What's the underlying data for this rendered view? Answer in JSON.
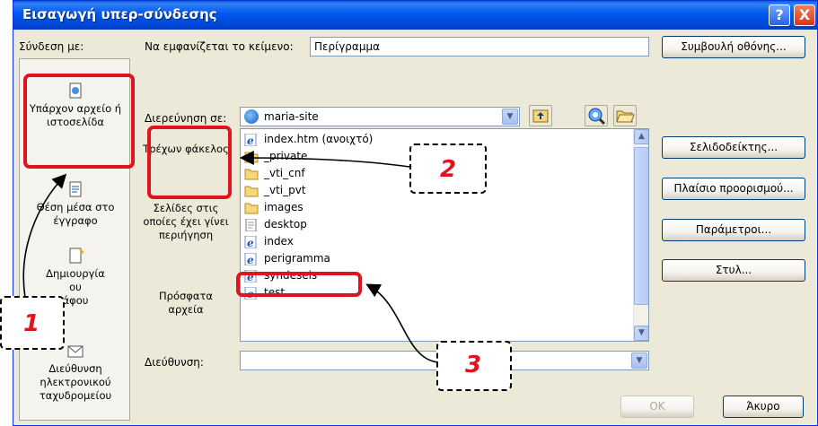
{
  "dialog": {
    "title": "Εισαγωγή υπερ-σύνδεσης",
    "help_glyph": "?",
    "close_glyph": "X"
  },
  "link_to_label": "Σύνδεση με:",
  "display_text": {
    "label": "Να εμφανίζεται το κείμενο:",
    "value": "Περίγραμμα"
  },
  "screentip_button": "Συμβουλή οθόνης...",
  "look_in": {
    "label": "Διερεύνηση σε:",
    "value": "maria-site"
  },
  "left_bar": [
    {
      "label": "Υπάρχον αρχείο ή ιστοσελίδα",
      "icon": "page-icon"
    },
    {
      "label": "Θέση μέσα στο έγγραφο",
      "icon": "document-place-icon"
    },
    {
      "label": "Δημιουργία νέου εγγράφου",
      "icon": "new-document-icon"
    },
    {
      "label": "Διεύθυνση ηλεκτρονικού ταχυδρομείου",
      "icon": "email-icon"
    }
  ],
  "left_bar_visible": {
    "item3_line1": "Δημιουργία",
    "item3_line2": "ου",
    "item3_line3": "άφου"
  },
  "middle_bar": [
    {
      "label": "Τρέχων φάκελος"
    },
    {
      "label": "Σελίδες στις οποίες έχει γίνει περιήγηση"
    },
    {
      "label": "Πρόσφατα αρχεία"
    }
  ],
  "files": [
    {
      "name": "index.htm (ανοιχτό)",
      "type": "html"
    },
    {
      "name": "_private",
      "type": "folder"
    },
    {
      "name": "_vti_cnf",
      "type": "folder"
    },
    {
      "name": "_vti_pvt",
      "type": "folder"
    },
    {
      "name": "images",
      "type": "folder"
    },
    {
      "name": "desktop",
      "type": "file"
    },
    {
      "name": "index",
      "type": "html"
    },
    {
      "name": "perigramma",
      "type": "html"
    },
    {
      "name": "syndeseis",
      "type": "html"
    },
    {
      "name": "test",
      "type": "html"
    }
  ],
  "right_buttons": {
    "bookmark": "Σελιδοδείκτης...",
    "target_frame": "Πλαίσιο προορισμού...",
    "parameters": "Παράμετροι...",
    "style": "Στυλ..."
  },
  "address": {
    "label": "Διεύθυνση:",
    "value": ""
  },
  "ok_button": "OK",
  "cancel_button": "Άκυρο",
  "callouts": {
    "one": "1",
    "two": "2",
    "three": "3"
  },
  "colors": {
    "highlight": "#e0141e",
    "titlebar": "#0058ee",
    "dialog_bg": "#ece9d8"
  }
}
